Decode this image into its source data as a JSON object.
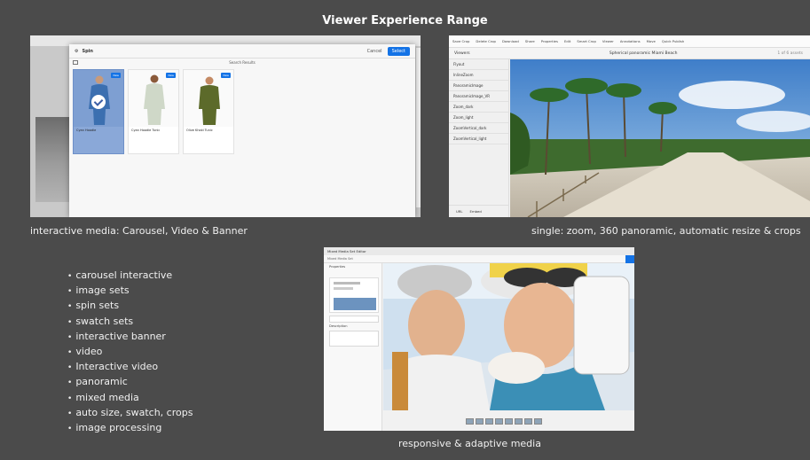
{
  "slide": {
    "title": "Viewer Experience Range"
  },
  "captions": {
    "interactive": "interactive media: Carousel, Video & Banner",
    "single": "single: zoom, 360 panoramic, automatic resize & crops",
    "responsive": "responsive & adaptive media"
  },
  "bullets": [
    "carousel interactive",
    "image sets",
    "spin sets",
    "swatch sets",
    "interactive banner",
    "video",
    "Interactive video",
    "panoramic",
    "mixed media",
    "auto size, swatch, crops",
    "image processing"
  ],
  "panel1": {
    "dialog_title": "Spin",
    "search_label": "Search Results",
    "cancel_label": "Cancel",
    "select_label": "Select",
    "cards": [
      {
        "title": "Cyan Hoodie",
        "badge": "New",
        "color": "#3b6fb0"
      },
      {
        "title": "Cyan Hoodie Tunic",
        "badge": "New",
        "color": "#cfd8c8"
      },
      {
        "title": "Olive Khaki Tunic",
        "badge": "New",
        "color": "#5c6a2a"
      }
    ]
  },
  "panel2": {
    "toolbar": [
      "Save Crop",
      "Delete Crop",
      "Download",
      "Share",
      "Properties",
      "Edit",
      "Smart Crop",
      "Viewer",
      "Annotations",
      "Move",
      "Quick Publish"
    ],
    "viewer_label": "Viewers",
    "title": "Spherical panoramic Miami Beach",
    "pages": "1 of 6 assets",
    "viewers": [
      "Flyout",
      "InlineZoom",
      "PanoramicImage",
      "PanoramicImage_VR",
      "Zoom_dark",
      "Zoom_light",
      "ZoomVertical_dark",
      "ZoomVertical_light"
    ],
    "footer": [
      "URL",
      "Embed"
    ]
  },
  "panel3": {
    "title": "Mixed Media Set Editor",
    "bar": "Mixed Media Set",
    "left_label": "Properties",
    "field_title": "Title",
    "field_desc": "Description"
  }
}
